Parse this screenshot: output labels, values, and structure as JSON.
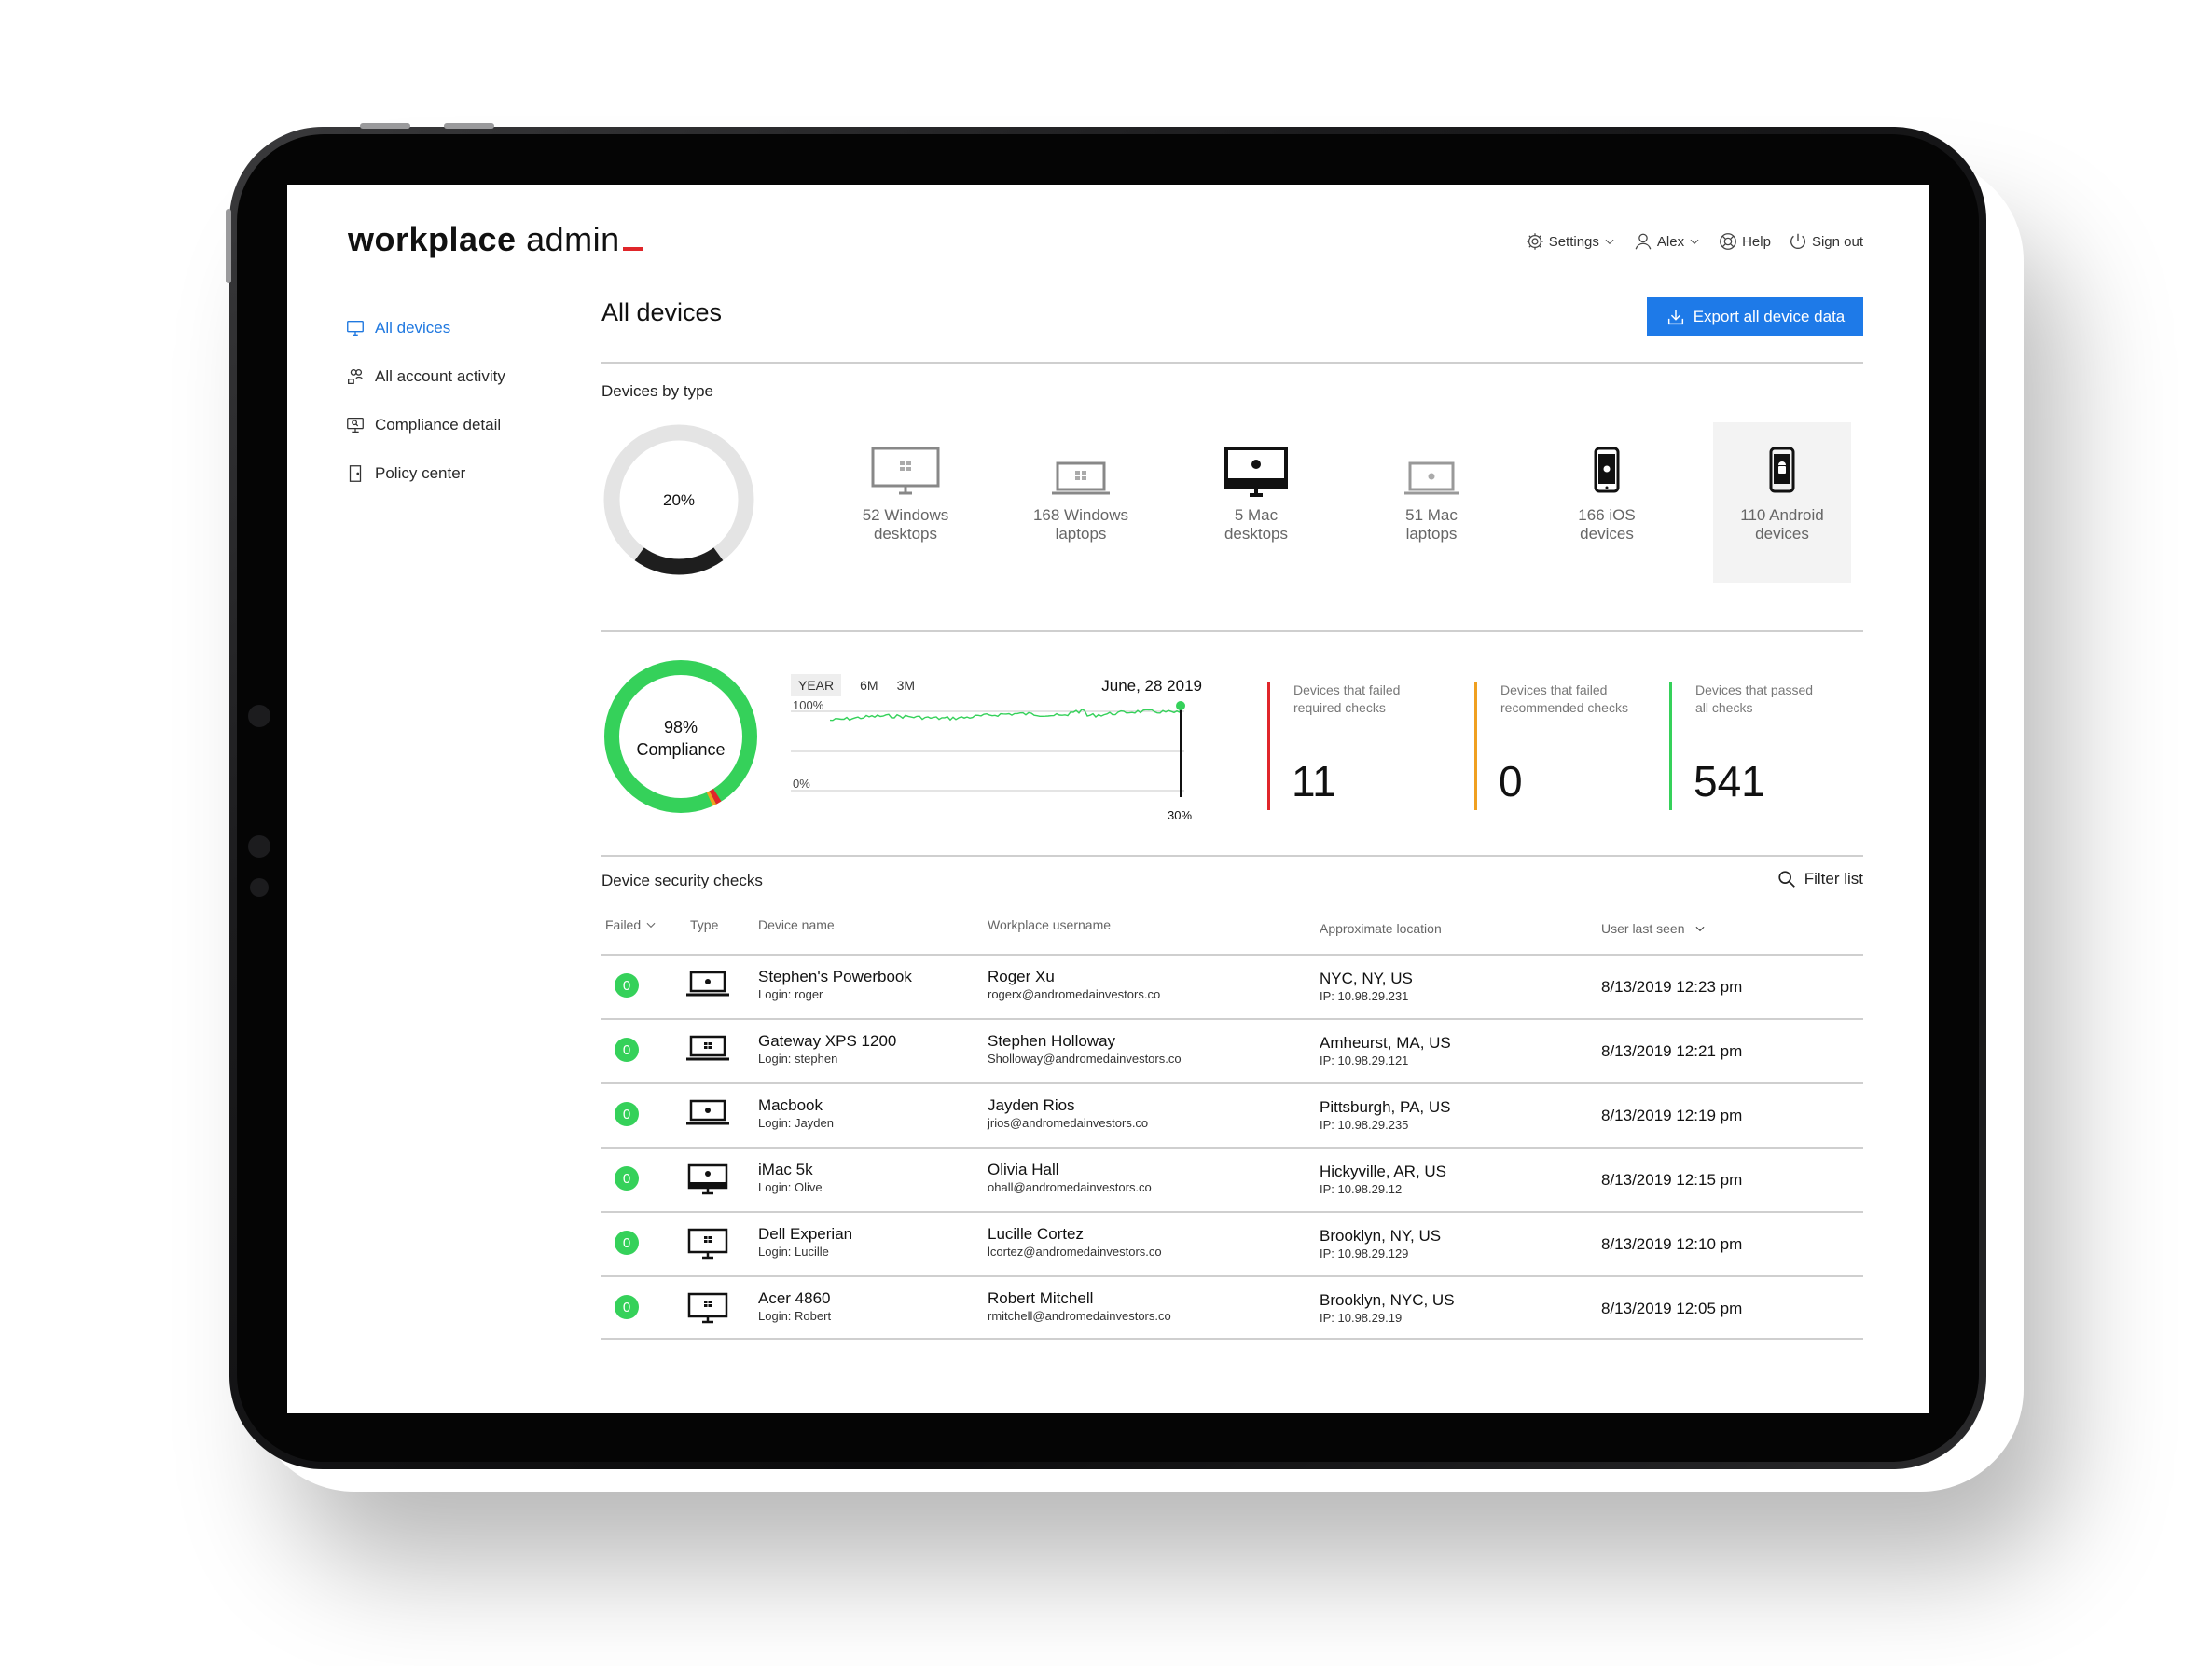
{
  "app": {
    "logo_bold": "workplace",
    "logo_light": "admin"
  },
  "topnav": {
    "settings": "Settings",
    "user": "Alex",
    "help": "Help",
    "signout": "Sign out"
  },
  "sidebar": {
    "items": [
      {
        "label": "All devices"
      },
      {
        "label": "All account activity"
      },
      {
        "label": "Compliance detail"
      },
      {
        "label": "Policy center"
      }
    ]
  },
  "page": {
    "title": "All devices",
    "export_label": "Export all device data"
  },
  "devices_by_type": {
    "title": "Devices by type",
    "donut_label": "20%",
    "donut_value": 0.2,
    "cards": [
      {
        "line1": "52 Windows",
        "line2": "desktops"
      },
      {
        "line1": "168 Windows",
        "line2": "laptops"
      },
      {
        "line1": "5 Mac",
        "line2": "desktops"
      },
      {
        "line1": "51 Mac",
        "line2": "laptops"
      },
      {
        "line1": "166 iOS",
        "line2": "devices"
      },
      {
        "line1": "110 Android",
        "line2": "devices"
      }
    ]
  },
  "compliance": {
    "pct_label": "98%",
    "label": "Compliance",
    "value": 0.98,
    "tabs": [
      "YEAR",
      "6M",
      "3M"
    ],
    "date": "June, 28 2019",
    "y_top": "100%",
    "y_bottom": "0%",
    "marker_label": "30%",
    "colors": {
      "green": "#35d15a",
      "red": "#e0262a",
      "orange": "#f0a020"
    }
  },
  "stats": [
    {
      "line1": "Devices that failed",
      "line2": "required checks",
      "value": "11",
      "color": "#e0262a"
    },
    {
      "line1": "Devices that failed",
      "line2": "recommended checks",
      "value": "0",
      "color": "#f0a020"
    },
    {
      "line1": "Devices that passed",
      "line2": "all checks",
      "value": "541",
      "color": "#35d15a"
    }
  ],
  "table": {
    "title": "Device security checks",
    "filter_label": "Filter list",
    "headers": {
      "failed": "Failed",
      "type": "Type",
      "device": "Device name",
      "username": "Workplace username",
      "location": "Approximate location",
      "seen": "User last seen"
    },
    "rows": [
      {
        "failed": "0",
        "type": "mac-laptop",
        "device": "Stephen's Powerbook",
        "login": "Login: roger",
        "name": "Roger Xu",
        "email": "rogerx@andromedainvestors.co",
        "loc": "NYC, NY, US",
        "ip": "IP: 10.98.29.231",
        "seen": "8/13/2019 12:23 pm"
      },
      {
        "failed": "0",
        "type": "win-laptop",
        "device": "Gateway XPS 1200",
        "login": "Login: stephen",
        "name": "Stephen Holloway",
        "email": "Sholloway@andromedainvestors.co",
        "loc": "Amheurst, MA, US",
        "ip": "IP: 10.98.29.121",
        "seen": "8/13/2019 12:21 pm"
      },
      {
        "failed": "0",
        "type": "mac-laptop",
        "device": "Macbook",
        "login": "Login: Jayden",
        "name": "Jayden Rios",
        "email": "jrios@andromedainvestors.co",
        "loc": "Pittsburgh, PA, US",
        "ip": "IP: 10.98.29.235",
        "seen": "8/13/2019 12:19 pm"
      },
      {
        "failed": "0",
        "type": "mac-desktop",
        "device": "iMac 5k",
        "login": "Login: Olive",
        "name": "Olivia Hall",
        "email": "ohall@andromedainvestors.co",
        "loc": "Hickyville, AR, US",
        "ip": "IP: 10.98.29.12",
        "seen": "8/13/2019 12:15 pm"
      },
      {
        "failed": "0",
        "type": "win-desktop",
        "device": "Dell Experian",
        "login": "Login: Lucille",
        "name": "Lucille Cortez",
        "email": "lcortez@andromedainvestors.co",
        "loc": "Brooklyn, NY, US",
        "ip": "IP: 10.98.29.129",
        "seen": "8/13/2019 12:10 pm"
      },
      {
        "failed": "0",
        "type": "win-desktop",
        "device": "Acer 4860",
        "login": "Login: Robert",
        "name": "Robert Mitchell",
        "email": "rmitchell@andromedainvestors.co",
        "loc": "Brooklyn, NYC, US",
        "ip": "IP: 10.98.29.19",
        "seen": "8/13/2019 12:05 pm"
      }
    ]
  }
}
